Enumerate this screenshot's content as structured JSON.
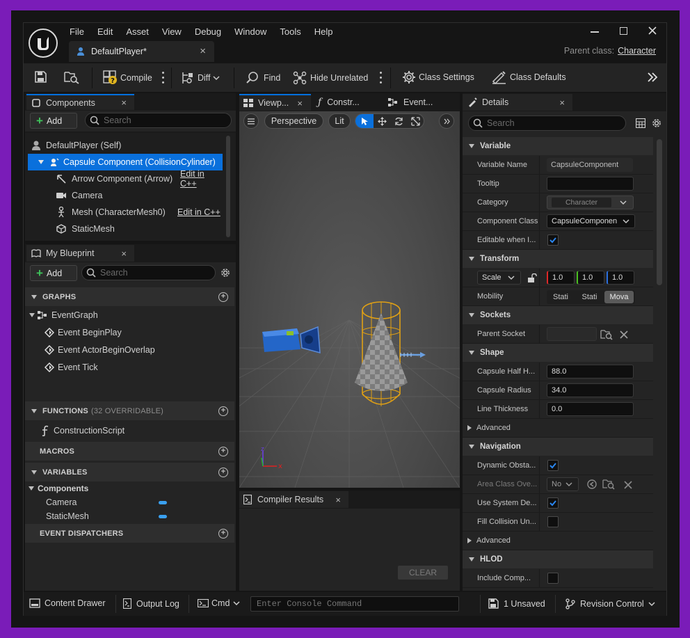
{
  "menu": [
    "File",
    "Edit",
    "Asset",
    "View",
    "Debug",
    "Window",
    "Tools",
    "Help"
  ],
  "window_controls": {
    "minimize_icon": "minimize-icon",
    "maximize_icon": "maximize-icon",
    "close_icon": "close-icon"
  },
  "asset_tab": {
    "label": "DefaultPlayer*",
    "close": "×"
  },
  "parent_class": {
    "label": "Parent class:",
    "value": "Character"
  },
  "toolbar": {
    "compile": "Compile",
    "diff": "Diff",
    "find": "Find",
    "hide_unrelated": "Hide Unrelated",
    "class_settings": "Class Settings",
    "class_defaults": "Class Defaults"
  },
  "components_panel": {
    "tab": "Components",
    "add": "Add",
    "search_placeholder": "Search",
    "items": [
      {
        "label": "DefaultPlayer (Self)",
        "edit": ""
      },
      {
        "label": "Capsule Component (CollisionCylinder)",
        "edit": ""
      },
      {
        "label": "Arrow Component (Arrow)",
        "edit": "Edit in C++"
      },
      {
        "label": "Camera",
        "edit": ""
      },
      {
        "label": "Mesh (CharacterMesh0)",
        "edit": "Edit in C++"
      },
      {
        "label": "StaticMesh",
        "edit": ""
      }
    ]
  },
  "blueprint_panel": {
    "tab": "My Blueprint",
    "add": "Add",
    "search_placeholder": "Search",
    "graphs": "GRAPHS",
    "event_graph": "EventGraph",
    "events": [
      "Event BeginPlay",
      "Event ActorBeginOverlap",
      "Event Tick"
    ],
    "functions": "FUNCTIONS",
    "functions_note": "(32 OVERRIDABLE)",
    "construction_script": "ConstructionScript",
    "macros": "MACROS",
    "variables": "VARIABLES",
    "components_cat": "Components",
    "variables_list": [
      "Camera",
      "StaticMesh"
    ],
    "event_dispatchers": "EVENT DISPATCHERS"
  },
  "viewport": {
    "tabs": [
      "Viewp...",
      "Constr...",
      "Event..."
    ],
    "perspective": "Perspective",
    "lit": "Lit"
  },
  "compiler": {
    "tab": "Compiler Results",
    "clear": "CLEAR"
  },
  "details": {
    "tab": "Details",
    "search_placeholder": "Search",
    "sections": {
      "variable": "Variable",
      "transform": "Transform",
      "sockets": "Sockets",
      "shape": "Shape",
      "advanced": "Advanced",
      "navigation": "Navigation",
      "advanced2": "Advanced",
      "hlod": "HLOD"
    },
    "variable_name": {
      "label": "Variable Name",
      "value": "CapsuleComponent"
    },
    "tooltip": {
      "label": "Tooltip",
      "value": ""
    },
    "category": {
      "label": "Category",
      "value": "Character"
    },
    "component_class": {
      "label": "Component Class",
      "value": "CapsuleComponen"
    },
    "editable": {
      "label": "Editable when I...",
      "checked": true
    },
    "scale": {
      "label": "Scale",
      "x": "1.0",
      "y": "1.0",
      "z": "1.0"
    },
    "mobility": {
      "label": "Mobility",
      "options": [
        "Stati",
        "Stati",
        "Mova"
      ]
    },
    "parent_socket": {
      "label": "Parent Socket"
    },
    "half_height": {
      "label": "Capsule Half H...",
      "value": "88.0"
    },
    "radius": {
      "label": "Capsule Radius",
      "value": "34.0"
    },
    "line_thickness": {
      "label": "Line Thickness",
      "value": "0.0"
    },
    "dynamic_obstacle": {
      "label": "Dynamic Obsta...",
      "checked": true
    },
    "area_class": {
      "label": "Area Class Ove...",
      "value": "No"
    },
    "use_system": {
      "label": "Use System De...",
      "checked": true
    },
    "fill_collision": {
      "label": "Fill Collision Un...",
      "checked": false
    },
    "include": {
      "label": "Include Comp..."
    }
  },
  "statusbar": {
    "content_drawer": "Content Drawer",
    "output_log": "Output Log",
    "cmd": "Cmd",
    "console_placeholder": "Enter Console Command",
    "unsaved": "1 Unsaved",
    "revision": "Revision Control"
  },
  "colors": {
    "accent_blue": "#0070e0",
    "purple_bg": "#7a1cb8",
    "check_blue": "#1a6ee8",
    "plus_green": "#3ec25a"
  }
}
